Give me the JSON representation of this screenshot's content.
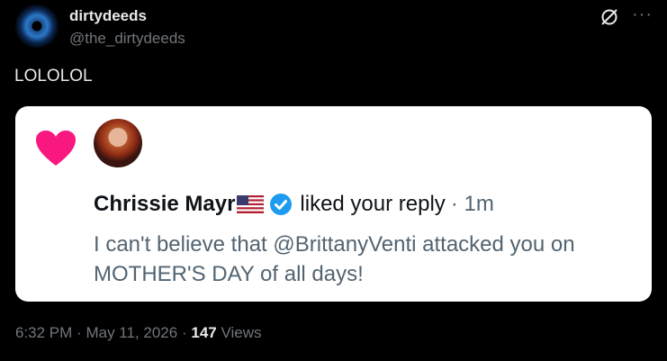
{
  "author": {
    "display_name": "dirtydeeds",
    "handle": "@the_dirtydeeds"
  },
  "post": {
    "text": "LOLOLOL"
  },
  "quoted_notification": {
    "user_name": "Chrissie Mayr",
    "action": "liked your reply",
    "separator": "·",
    "time": "1m",
    "text": "I can't believe that @BrittanyVenti attacked you on MOTHER'S DAY of all days!",
    "icons": [
      "heart-icon",
      "us-flag-icon",
      "verified-badge-icon"
    ],
    "heart_color": "#f91880",
    "verified_color": "#1d9bf0"
  },
  "meta": {
    "time": "6:32 PM",
    "sep1": "·",
    "date": "May 11, 2026",
    "sep2": "·",
    "views_count": "147",
    "views_label": "Views"
  },
  "header_actions": {
    "grok_icon": "grok-icon",
    "more_icon": "more-icon",
    "more_glyph": "···"
  }
}
